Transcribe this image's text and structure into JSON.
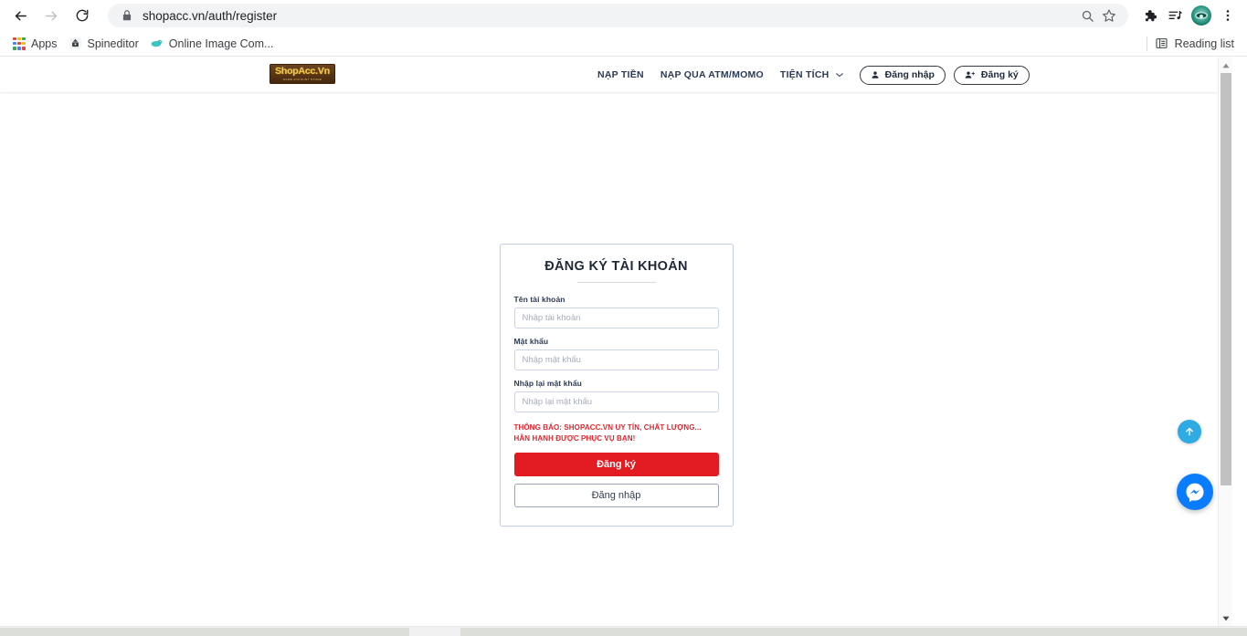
{
  "browser": {
    "back_label": "Back",
    "forward_label": "Forward",
    "reload_label": "Reload",
    "url": "shopacc.vn/auth/register",
    "lock_icon": "lock-icon",
    "zoom_search_icon": "search-icon",
    "bookmark_star_icon": "star-icon",
    "extensions_icon": "puzzle-piece-icon",
    "media_icon": "playlist-music-icon",
    "profile_icon": "avatar-icon",
    "menu_icon": "three-dot-menu-icon",
    "bookmarks": [
      {
        "label": "Apps",
        "icon": "apps-grid-icon"
      },
      {
        "label": "Spineditor",
        "icon": "spineditor-favicon"
      },
      {
        "label": "Online Image Com...",
        "icon": "online-image-favicon"
      }
    ],
    "reading_list": {
      "label": "Reading list",
      "icon": "reading-list-icon"
    }
  },
  "site": {
    "logo": {
      "text": "ShopAcc.Vn",
      "sub": "GAME ACCOUNT STORE"
    },
    "nav": [
      {
        "label": "NẠP TIỀN",
        "has_caret": false
      },
      {
        "label": "NẠP QUA ATM/MOMO",
        "has_caret": false
      },
      {
        "label": "TIỆN TÍCH",
        "has_caret": true
      }
    ],
    "auth_buttons": [
      {
        "label": "Đăng nhập",
        "icon": "user-icon"
      },
      {
        "label": "Đăng ký",
        "icon": "user-plus-icon"
      }
    ]
  },
  "register_card": {
    "title": "ĐĂNG KÝ TÀI KHOẢN",
    "fields": [
      {
        "label": "Tên tài khoản",
        "placeholder": "Nhập tài khoản",
        "value": "",
        "type": "text"
      },
      {
        "label": "Mật khẩu",
        "placeholder": "Nhập mật khẩu",
        "value": "",
        "type": "password"
      },
      {
        "label": "Nhập lại mật khẩu",
        "placeholder": "Nhập lại mật khẩu",
        "value": "",
        "type": "password"
      }
    ],
    "notice": "THÔNG BÁO: SHOPACC.VN UY TÍN, CHẤT LƯỢNG... HÂN HẠNH ĐƯỢC PHỤC VỤ BẠN!",
    "submit_label": "Đăng ký",
    "login_label": "Đăng nhập"
  },
  "floating": {
    "scroll_top_icon": "arrow-up-icon",
    "messenger_icon": "messenger-icon"
  },
  "colors": {
    "accent_red": "#e21b22",
    "notice_red": "#e0252c",
    "navy": "#2b3a55",
    "logo_gold": "#f7c944",
    "messenger_blue": "#0a7cff",
    "scrolltop_blue": "#2eaae4"
  }
}
